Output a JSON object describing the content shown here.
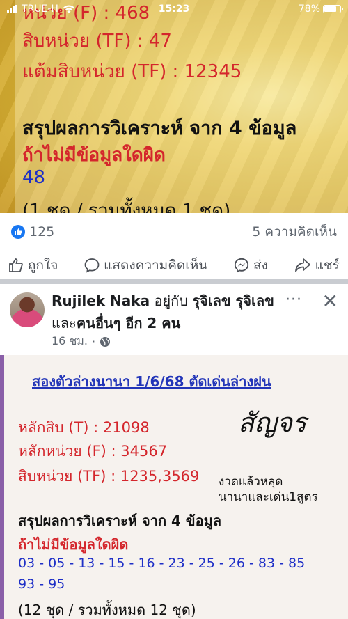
{
  "status_bar": {
    "carrier": "TRUE-H",
    "time": "15:23",
    "battery": "78%"
  },
  "post1": {
    "image_lines": {
      "top_cut": "หน่วย (F) : 468",
      "tens_units": "สิบหน่วย (TF) : 47",
      "score_tens_units": "แต้มสิบหน่วย (TF) : 12345",
      "summary": "สรุปผลการวิเคราะห์ จาก 4 ข้อมูล",
      "condition": "ถ้าไม่มีข้อมูลใดผิด",
      "result": "48",
      "total": "(1 ชุด / รวมทั้งหมด 1 ชุด)"
    },
    "like_count": "125",
    "comment_count": "5 ความคิดเห็น",
    "actions": {
      "like": "ถูกใจ",
      "comment": "แสดงความคิดเห็น",
      "messenger": "ส่ง",
      "share": "แชร์"
    }
  },
  "post2": {
    "author": "Rujilek Naka",
    "with_text": "อยู่กับ",
    "tagged": "รุจิเลข รุจิเลข",
    "and_text": "และ",
    "others": "คนอื่นๆ อีก 2 คน",
    "time": "16 ชม.",
    "image": {
      "title": "สองตัวล่างนานา 1/6/68 ตัดเด่นล่างฝน",
      "tens": "หลักสิบ (T) : 21098",
      "units": "หลักหน่วย (F) : 34567",
      "tens_units": "สิบหน่วย (TF) : 1235,3569",
      "handwritten": "สัญจร",
      "note1": "งวดแล้วหลุด",
      "note2": "นานาและเด่น1สูตร",
      "summary": "สรุปผลการวิเคราะห์ จาก 4 ข้อมูล",
      "condition": "ถ้าไม่มีข้อมูลใดผิด",
      "numbers1": "03 - 05 - 13 - 15 - 16 - 23 - 25 - 26 - 83 - 85",
      "numbers2": "93 - 95",
      "total": "(12 ชุด / รวมทั้งหมด 12 ชุด)"
    }
  },
  "colors": {
    "accent": "#1877f2",
    "red_text": "#d4262c",
    "blue_text": "#1e2fc7"
  }
}
